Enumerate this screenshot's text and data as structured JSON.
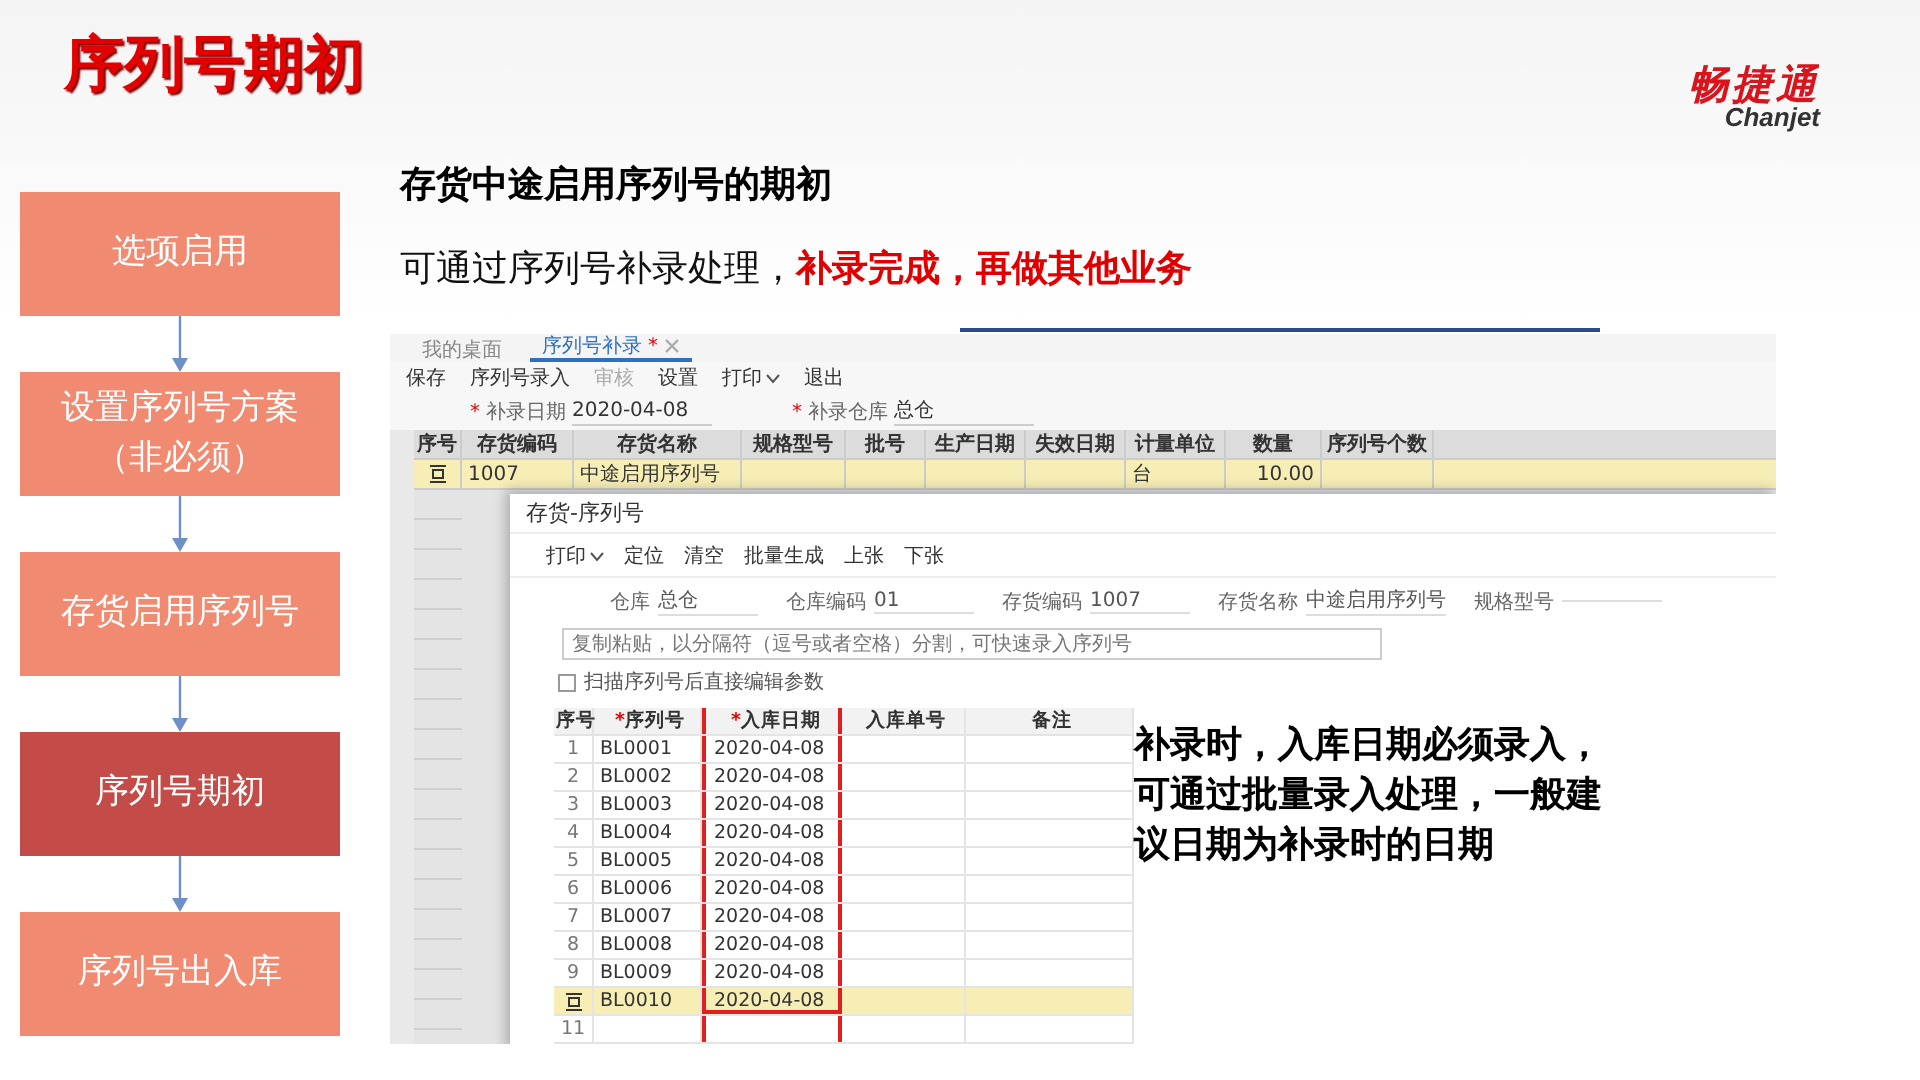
{
  "title": "序列号期初",
  "logo": {
    "name": "畅捷通",
    "subtitle": "Chanjet"
  },
  "flow_steps": [
    {
      "label": "选项启用",
      "selected": false
    },
    {
      "label": "设置序列号方案（非必须）",
      "selected": false
    },
    {
      "label": "存货启用序列号",
      "selected": false
    },
    {
      "label": "序列号期初",
      "selected": true
    },
    {
      "label": "序列号出入库",
      "selected": false
    }
  ],
  "heading": "存货中途启用序列号的期初",
  "note": {
    "text": "可通过序列号补录处理，",
    "emphasis": "补录完成，再做其他业务"
  },
  "screenshot": {
    "tabs": [
      {
        "label": "我的桌面",
        "selected": false,
        "closable": false
      },
      {
        "label": "序列号补录",
        "selected": true,
        "modified_mark": "*",
        "closable": true
      }
    ],
    "toolbar": [
      {
        "label": "保存",
        "disabled": false,
        "dropdown": false
      },
      {
        "label": "序列号录入",
        "disabled": false,
        "dropdown": false
      },
      {
        "label": "审核",
        "disabled": true,
        "dropdown": false
      },
      {
        "label": "设置",
        "disabled": false,
        "dropdown": false
      },
      {
        "label": "打印",
        "disabled": false,
        "dropdown": true
      },
      {
        "label": "退出",
        "disabled": false,
        "dropdown": false
      }
    ],
    "fields": [
      {
        "label": "补录日期",
        "required_mark": "*",
        "value": "2020-04-08"
      },
      {
        "label": "补录仓库",
        "required_mark": "*",
        "value": "总仓"
      }
    ],
    "table": {
      "columns": [
        "序号",
        "存货编码",
        "存货名称",
        "规格型号",
        "批号",
        "生产日期",
        "失效日期",
        "计量单位",
        "数量",
        "序列号个数"
      ],
      "rows": [
        {
          "selected": true,
          "cells": [
            "",
            "1007",
            "中途启用序列号",
            "",
            "",
            "",
            "",
            "台",
            "10.00",
            ""
          ]
        }
      ]
    },
    "dialog": {
      "title": "存货-序列号",
      "toolbar": [
        {
          "label": "打印",
          "dropdown": true
        },
        {
          "label": "定位",
          "dropdown": false
        },
        {
          "label": "清空",
          "dropdown": false
        },
        {
          "label": "批量生成",
          "dropdown": false
        },
        {
          "label": "上张",
          "dropdown": false
        },
        {
          "label": "下张",
          "dropdown": false
        }
      ],
      "fields": [
        {
          "label": "仓库",
          "value": "总仓"
        },
        {
          "label": "仓库编码",
          "value": "01"
        },
        {
          "label": "存货编码",
          "value": "1007"
        },
        {
          "label": "存货名称",
          "value": "中途启用序列号"
        },
        {
          "label": "规格型号"
        }
      ],
      "input": {
        "placeholder": "复制粘贴，以分隔符（逗号或者空格）分割，可快速录入序列号"
      },
      "checkbox": {
        "label": "扫描序列号后直接编辑参数",
        "checked": false
      },
      "columns": [
        {
          "label": "序号",
          "highlighted": false
        },
        {
          "label": "序列号",
          "required_mark": "*",
          "highlighted": false
        },
        {
          "label": "入库日期",
          "required_mark": "*",
          "highlighted": true
        },
        {
          "label": "入库单号",
          "highlighted": false
        },
        {
          "label": "备注",
          "highlighted": false
        }
      ],
      "rows": [
        {
          "selected": false,
          "cells": [
            "1",
            "BL0001",
            "2020-04-08",
            "",
            ""
          ]
        },
        {
          "selected": false,
          "cells": [
            "2",
            "BL0002",
            "2020-04-08",
            "",
            ""
          ]
        },
        {
          "selected": false,
          "cells": [
            "3",
            "BL0003",
            "2020-04-08",
            "",
            ""
          ]
        },
        {
          "selected": false,
          "cells": [
            "4",
            "BL0004",
            "2020-04-08",
            "",
            ""
          ]
        },
        {
          "selected": false,
          "cells": [
            "5",
            "BL0005",
            "2020-04-08",
            "",
            ""
          ]
        },
        {
          "selected": false,
          "cells": [
            "6",
            "BL0006",
            "2020-04-08",
            "",
            ""
          ]
        },
        {
          "selected": false,
          "cells": [
            "7",
            "BL0007",
            "2020-04-08",
            "",
            ""
          ]
        },
        {
          "selected": false,
          "cells": [
            "8",
            "BL0008",
            "2020-04-08",
            "",
            ""
          ]
        },
        {
          "selected": false,
          "cells": [
            "9",
            "BL0009",
            "2020-04-08",
            "",
            ""
          ]
        },
        {
          "selected": true,
          "cells": [
            "",
            "BL0010",
            "2020-04-08",
            "",
            ""
          ]
        },
        {
          "selected": false,
          "cells": [
            "11",
            "",
            "",
            "",
            ""
          ]
        }
      ]
    }
  },
  "annotation": "补录时，入库日期必须录入，可通过批量录入处理，一般建议日期为补录时的日期"
}
